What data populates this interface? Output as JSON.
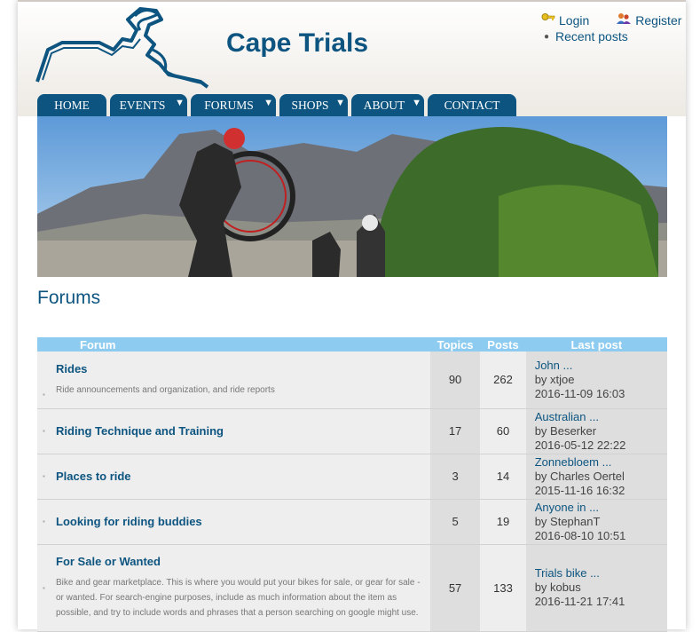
{
  "site": {
    "title": "Cape Trials"
  },
  "user_links": {
    "login": "Login",
    "register": "Register",
    "recent": "Recent posts"
  },
  "nav": [
    {
      "label": "HOME",
      "dropdown": false
    },
    {
      "label": "EVENTS",
      "dropdown": true
    },
    {
      "label": "FORUMS",
      "dropdown": true
    },
    {
      "label": "SHOPS",
      "dropdown": true
    },
    {
      "label": "ABOUT",
      "dropdown": true
    },
    {
      "label": "CONTACT",
      "dropdown": false
    }
  ],
  "page": {
    "title": "Forums"
  },
  "table": {
    "headers": {
      "forum": "Forum",
      "topics": "Topics",
      "posts": "Posts",
      "last_post": "Last post"
    },
    "rows": [
      {
        "name": "Rides",
        "desc": "Ride announcements and organization, and ride reports",
        "topics": "90",
        "posts": "262",
        "last_title": "John ...",
        "last_by": "by xtjoe",
        "last_date": "2016-11-09 16:03"
      },
      {
        "name": "Riding Technique and Training",
        "desc": "",
        "topics": "17",
        "posts": "60",
        "last_title": "Australian ...",
        "last_by": "by Beserker",
        "last_date": "2016-05-12 22:22"
      },
      {
        "name": "Places to ride",
        "desc": "",
        "topics": "3",
        "posts": "14",
        "last_title": "Zonnebloem ...",
        "last_by": "by Charles Oertel",
        "last_date": "2015-11-16 16:32"
      },
      {
        "name": "Looking for riding buddies",
        "desc": "",
        "topics": "5",
        "posts": "19",
        "last_title": "Anyone in ...",
        "last_by": "by StephanT",
        "last_date": "2016-08-10 10:51"
      },
      {
        "name": "For Sale or Wanted",
        "desc": "Bike and gear marketplace. This is where you would put your bikes for sale, or gear for sale - or wanted. For search-engine purposes, include as much information about the item as possible, and try to include words and phrases that a person searching on google might use.",
        "topics": "57",
        "posts": "133",
        "last_title": "Trials bike ...",
        "last_by": "by kobus",
        "last_date": "2016-11-21 17:41"
      }
    ]
  }
}
